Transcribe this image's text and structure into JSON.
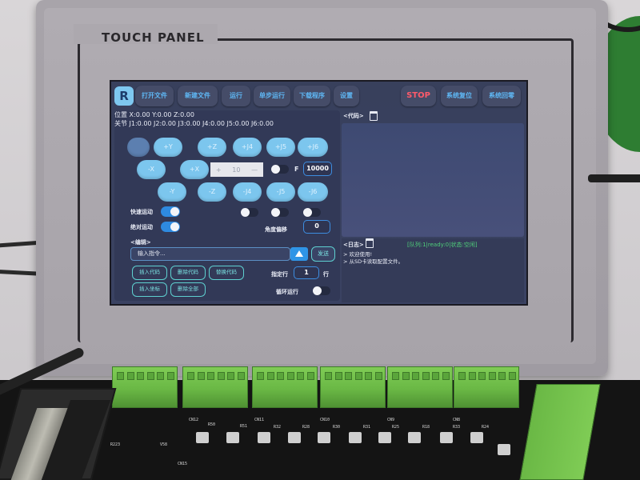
{
  "device": {
    "panel_label": "TOUCH  PANEL"
  },
  "app": {
    "logo": "R",
    "toolbar": [
      {
        "label": "打开文件"
      },
      {
        "label": "新建文件"
      },
      {
        "label": "运行"
      },
      {
        "label": "单步运行"
      },
      {
        "label": "下载程序"
      },
      {
        "label": "设置"
      }
    ],
    "toolbar_right": [
      {
        "label": "STOP"
      },
      {
        "label": "系统复位"
      },
      {
        "label": "系统回零"
      }
    ],
    "position": {
      "line1": "位置 X:0.00 Y:0.00 Z:0.00",
      "line2": "关节 J1:0.00 J2:0.00 J3:0.00 J4:0.00 J5:0.00 J6:0.00"
    },
    "jog": {
      "row1": [
        "",
        "+Y",
        "+Z",
        "+J4",
        "+J5",
        "+J6"
      ],
      "row2": [
        "-X",
        "+X"
      ],
      "row3": [
        "-Y",
        "-Z",
        "-J4",
        "-J5",
        "-J6"
      ],
      "step": {
        "minus": "+",
        "value": "10",
        "plus": "—"
      },
      "feed_label": "F",
      "feed_value": "10000"
    },
    "toggles": {
      "fast_move_label": "快速运动",
      "fast_move_on": true,
      "absolute_move_label": "绝对运动",
      "absolute_move_on": true,
      "angle_offset_label": "角度偏移",
      "angle_offset_value": "0"
    },
    "editor": {
      "header": "<编辑>",
      "input_placeholder": "输入指令...",
      "send_label": "发送",
      "buttons": [
        "插入代码",
        "删除代码",
        "替换代码",
        "插入坐标",
        "删除全部"
      ],
      "line_label": "指定行",
      "line_value": "1",
      "line_suffix": "行",
      "loop_label": "循环运行",
      "loop_on": false
    },
    "code_panel": {
      "header": "<代码>"
    },
    "log_panel": {
      "header": "<日志>",
      "status": "[队列:1|ready:0|状态:空闲]",
      "lines": [
        "> 欢迎使用!",
        "> 从SD卡读取配置文件。"
      ]
    }
  },
  "pcb": {
    "connectors": [
      "CN12",
      "CN11",
      "CN10",
      "CN9",
      "CN8"
    ],
    "resistors": [
      "R50",
      "R51",
      "R32",
      "R28",
      "R30",
      "R31",
      "R25",
      "R18",
      "R33",
      "R24"
    ],
    "extra": [
      "CN15",
      "R223",
      "V58"
    ]
  }
}
